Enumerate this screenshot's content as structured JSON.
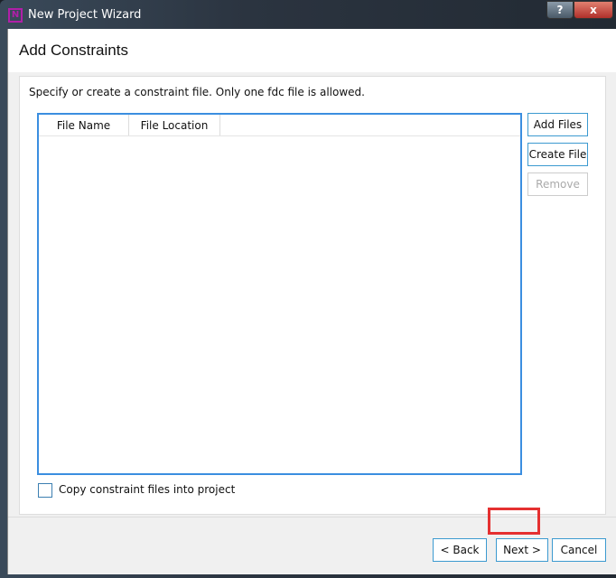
{
  "window": {
    "title": "New Project Wizard",
    "help": "?",
    "close": "x",
    "logo": "N"
  },
  "page": {
    "title": "Add Constraints",
    "instruction": "Specify or create a constraint file. Only one fdc file is allowed."
  },
  "table": {
    "columns": [
      "File Name",
      "File Location"
    ],
    "rows": []
  },
  "side_buttons": {
    "add": "Add Files",
    "create": "Create File",
    "remove": "Remove"
  },
  "checkbox": {
    "label": "Copy constraint files into project",
    "checked": false
  },
  "footer": {
    "back": "< Back",
    "next": "Next >",
    "cancel": "Cancel"
  }
}
